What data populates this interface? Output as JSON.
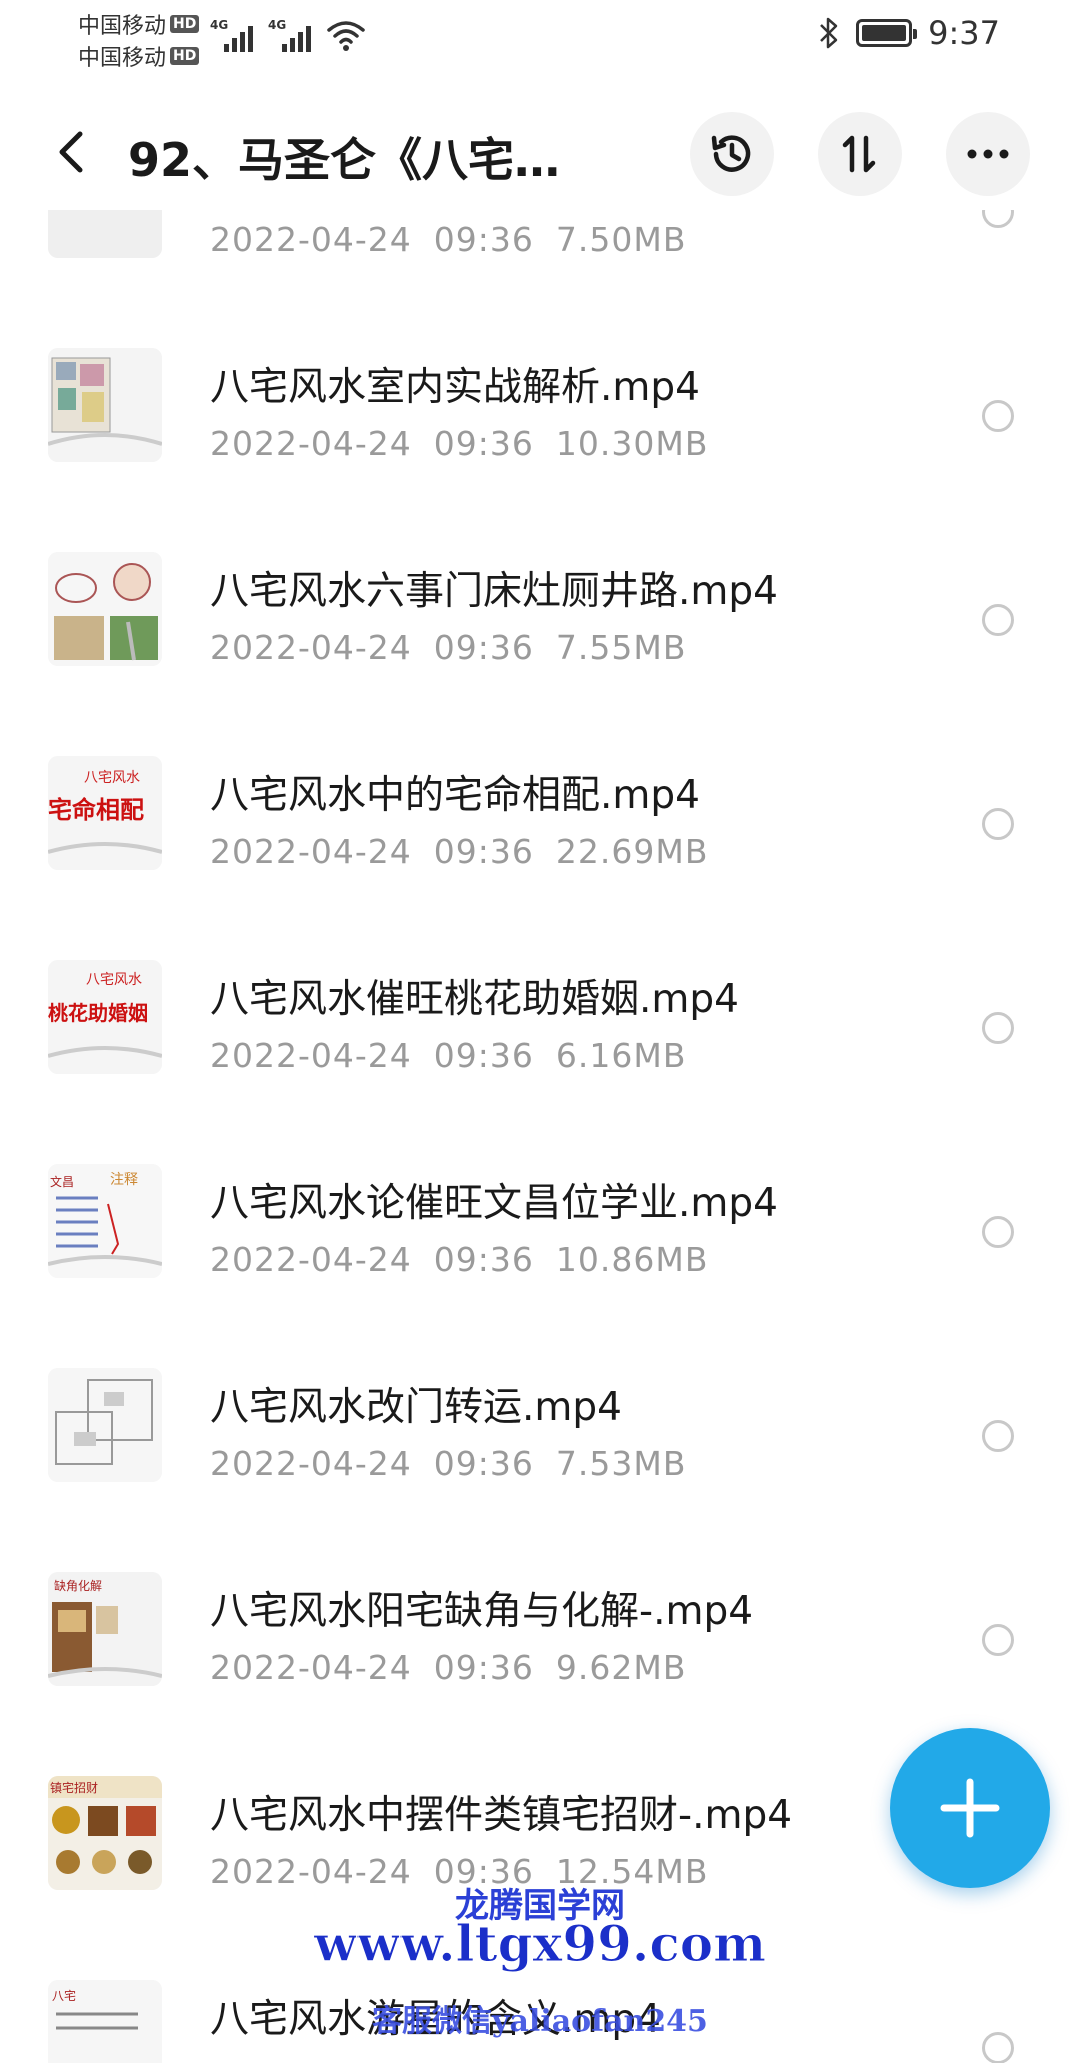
{
  "status_bar": {
    "carrier1": "中国移动",
    "carrier2": "中国移动",
    "hd_badge": "HD",
    "network_type": "4G",
    "time": "9:37"
  },
  "header": {
    "title": "92、马圣仑《八宅…"
  },
  "files": [
    {
      "name": "",
      "date": "2022-04-24",
      "time": "09:36",
      "size": "7.50MB",
      "thumb": "gold"
    },
    {
      "name": "八宅风水室内实战解析.mp4",
      "date": "2022-04-24",
      "time": "09:36",
      "size": "10.30MB",
      "thumb": "floorplan"
    },
    {
      "name": "八宅风水六事门床灶厕井路.mp4",
      "date": "2022-04-24",
      "time": "09:36",
      "size": "7.55MB",
      "thumb": "sketch"
    },
    {
      "name": "八宅风水中的宅命相配.mp4",
      "date": "2022-04-24",
      "time": "09:36",
      "size": "22.69MB",
      "thumb": "redtext"
    },
    {
      "name": "八宅风水催旺桃花助婚姻.mp4",
      "date": "2022-04-24",
      "time": "09:36",
      "size": "6.16MB",
      "thumb": "redtext2"
    },
    {
      "name": "八宅风水论催旺文昌位学业.mp4",
      "date": "2022-04-24",
      "time": "09:36",
      "size": "10.86MB",
      "thumb": "notes"
    },
    {
      "name": "八宅风水改门转运.mp4",
      "date": "2022-04-24",
      "time": "09:36",
      "size": "7.53MB",
      "thumb": "diagram"
    },
    {
      "name": "八宅风水阳宅缺角与化解-.mp4",
      "date": "2022-04-24",
      "time": "09:36",
      "size": "9.62MB",
      "thumb": "room"
    },
    {
      "name": "八宅风水中摆件类镇宅招财-.mp4",
      "date": "2022-04-24",
      "time": "09:36",
      "size": "12.54MB",
      "thumb": "objects"
    },
    {
      "name": "八宅风水游星的含义.mp4",
      "date": "",
      "time": "",
      "size": "",
      "thumb": "notes2"
    }
  ],
  "watermark": {
    "line1": "龙腾国学网",
    "line2": "www.ltgx99.com",
    "line3": "客服微信yaliaofan245"
  },
  "colors": {
    "accent": "#22a9e8",
    "meta_text": "#9a9a9a",
    "watermark": "#1b2fc9"
  },
  "icons": {
    "back": "chevron-left-icon",
    "history": "history-icon",
    "sort": "sort-icon",
    "more": "more-horizontal-icon",
    "fab": "plus-icon"
  }
}
